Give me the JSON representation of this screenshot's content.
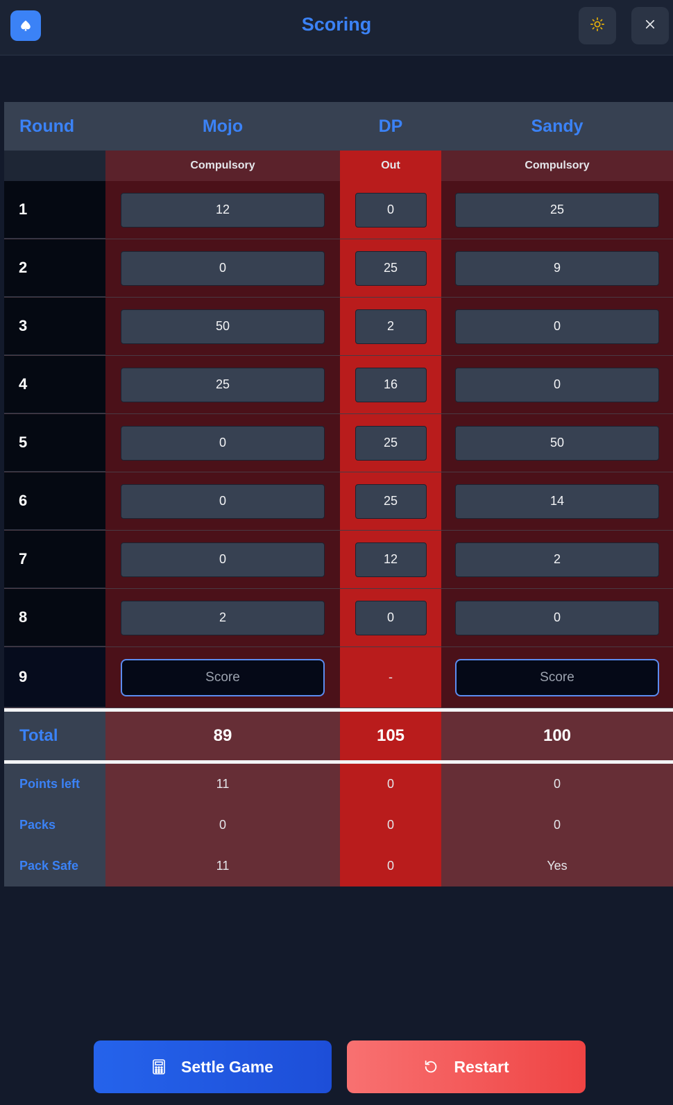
{
  "header": {
    "title": "Scoring",
    "icons": {
      "logo": "spade-icon",
      "theme": "sun-icon",
      "close": "close-icon"
    }
  },
  "table": {
    "round_label": "Round",
    "players": [
      {
        "name": "Mojo",
        "status": "Compulsory"
      },
      {
        "name": "DP",
        "status": "Out"
      },
      {
        "name": "Sandy",
        "status": "Compulsory"
      }
    ],
    "rounds": [
      {
        "round": "1",
        "scores": [
          "12",
          "0",
          "25"
        ]
      },
      {
        "round": "2",
        "scores": [
          "0",
          "25",
          "9"
        ]
      },
      {
        "round": "3",
        "scores": [
          "50",
          "2",
          "0"
        ]
      },
      {
        "round": "4",
        "scores": [
          "25",
          "16",
          "0"
        ]
      },
      {
        "round": "5",
        "scores": [
          "0",
          "25",
          "50"
        ]
      },
      {
        "round": "6",
        "scores": [
          "0",
          "25",
          "14"
        ]
      },
      {
        "round": "7",
        "scores": [
          "0",
          "12",
          "2"
        ]
      },
      {
        "round": "8",
        "scores": [
          "2",
          "0",
          "0"
        ]
      }
    ],
    "current_round": {
      "round": "9",
      "placeholder": "Score",
      "out_value": "-"
    },
    "total": {
      "label": "Total",
      "values": [
        "89",
        "105",
        "100"
      ]
    },
    "stats": [
      {
        "label": "Points left",
        "values": [
          "11",
          "0",
          "0"
        ]
      },
      {
        "label": "Packs",
        "values": [
          "0",
          "0",
          "0"
        ]
      },
      {
        "label": "Pack Safe",
        "values": [
          "11",
          "0",
          "Yes"
        ]
      }
    ]
  },
  "actions": {
    "settle_label": "Settle Game",
    "restart_label": "Restart",
    "settle_icon": "calculator-icon",
    "restart_icon": "restart-icon"
  },
  "colors": {
    "accent": "#3b82f6",
    "out_column": "#b91c1c",
    "compulsory_column": "#4b1119",
    "settle": "#2563eb",
    "restart": "#ef4444",
    "sun": "#eab308"
  }
}
